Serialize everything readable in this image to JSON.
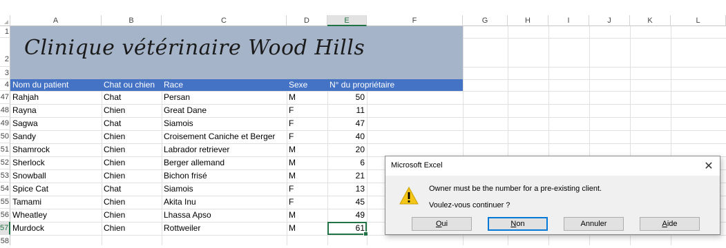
{
  "columns": [
    "A",
    "B",
    "C",
    "D",
    "E",
    "F",
    "G",
    "H",
    "I",
    "J",
    "K",
    "L"
  ],
  "selected_column": "E",
  "title_text": "Clinique vétérinaire Wood Hills",
  "header": [
    "Nom du patient",
    "Chat ou chien",
    "Race",
    "Sexe",
    "N° du propriétaire"
  ],
  "top_row_numbers": [
    "1",
    "2",
    "3",
    "4"
  ],
  "rows": [
    {
      "num": "47",
      "name": "Rahjah",
      "type": "Chat",
      "breed": "Persan",
      "sex": "M",
      "owner": "50"
    },
    {
      "num": "48",
      "name": "Rayna",
      "type": "Chien",
      "breed": "Great Dane",
      "sex": "F",
      "owner": "11"
    },
    {
      "num": "49",
      "name": "Sagwa",
      "type": "Chat",
      "breed": "Siamois",
      "sex": "F",
      "owner": "47"
    },
    {
      "num": "50",
      "name": "Sandy",
      "type": "Chien",
      "breed": "Croisement Caniche et Berger",
      "sex": "F",
      "owner": "40"
    },
    {
      "num": "51",
      "name": "Shamrock",
      "type": "Chien",
      "breed": "Labrador retriever",
      "sex": "M",
      "owner": "20"
    },
    {
      "num": "52",
      "name": "Sherlock",
      "type": "Chien",
      "breed": "Berger allemand",
      "sex": "M",
      "owner": "6"
    },
    {
      "num": "53",
      "name": "Snowball",
      "type": "Chien",
      "breed": "Bichon frisé",
      "sex": "M",
      "owner": "21"
    },
    {
      "num": "54",
      "name": "Spice Cat",
      "type": "Chat",
      "breed": "Siamois",
      "sex": "F",
      "owner": "13"
    },
    {
      "num": "55",
      "name": "Tamami",
      "type": "Chien",
      "breed": "Akita Inu",
      "sex": "F",
      "owner": "45"
    },
    {
      "num": "56",
      "name": "Wheatley",
      "type": "Chien",
      "breed": "Lhassa Apso",
      "sex": "M",
      "owner": "49"
    },
    {
      "num": "57",
      "name": "Murdock",
      "type": "Chien",
      "breed": "Rottweiler",
      "sex": "M",
      "owner": "61"
    }
  ],
  "last_row_number": "58",
  "active_row": "57",
  "dialog": {
    "title": "Microsoft Excel",
    "close_icon": "close-icon",
    "icon": "warning-icon",
    "message": "Owner must be the number for a pre-existing client.",
    "question": "Voulez-vous continuer ?",
    "buttons": {
      "yes_ul": "O",
      "yes_rest": "ui",
      "no_ul": "N",
      "no_rest": "on",
      "cancel": "Annuler",
      "help_ul": "A",
      "help_rest": "ide"
    }
  },
  "colors": {
    "title_band": "#a5b4c8",
    "header_band": "#4472c4",
    "selection": "#217346",
    "warning": "#f5c518"
  }
}
